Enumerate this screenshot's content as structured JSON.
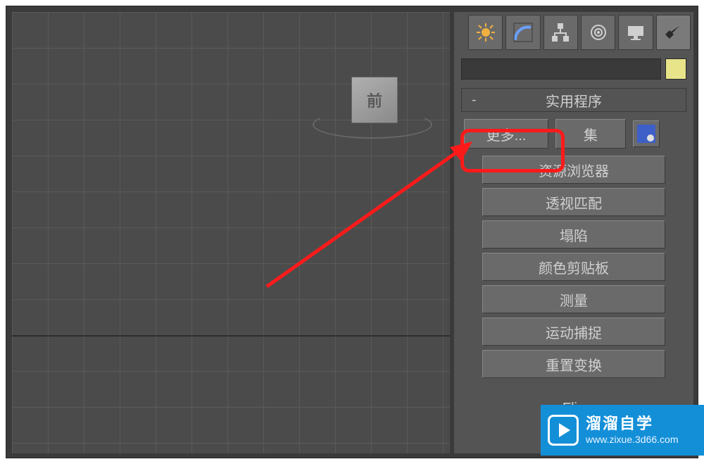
{
  "viewport": {
    "cube_face": "前"
  },
  "tabs": {
    "icons": [
      "create",
      "modify",
      "hierarchy",
      "motion",
      "display",
      "utilities"
    ]
  },
  "rollout": {
    "title": "实用程序",
    "collapse": "-"
  },
  "top_buttons": {
    "more": "更多...",
    "sets": "集"
  },
  "utilities": [
    "资源浏览器",
    "透视匹配",
    "塌陷",
    "颜色剪贴板",
    "测量",
    "运动捕捉",
    "重置变换"
  ],
  "flight_label": "Flig",
  "watermark": {
    "title": "溜溜自学",
    "url": "www.zixue.3d66.com"
  }
}
